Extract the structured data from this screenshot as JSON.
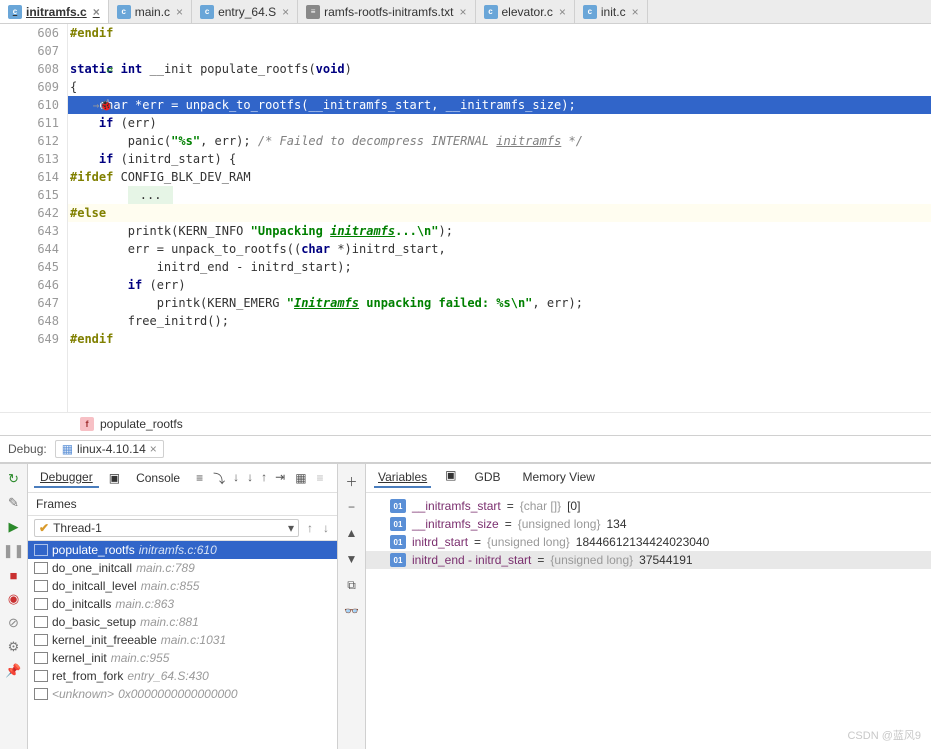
{
  "tabs": [
    {
      "label": "initramfs.c",
      "icon": "c",
      "active": true
    },
    {
      "label": "main.c",
      "icon": "c"
    },
    {
      "label": "entry_64.S",
      "icon": "c"
    },
    {
      "label": "ramfs-rootfs-initramfs.txt",
      "icon": "txt"
    },
    {
      "label": "elevator.c",
      "icon": "c"
    },
    {
      "label": "init.c",
      "icon": "c"
    }
  ],
  "gutter_lines": [
    "606",
    "607",
    "608",
    "609",
    "610",
    "611",
    "612",
    "613",
    "614",
    "615",
    "642",
    "643",
    "644",
    "645",
    "646",
    "647",
    "648",
    "649"
  ],
  "breakpoint_line": "610",
  "folded_line": "615",
  "crumb": {
    "badge": "f",
    "name": "populate_rootfs"
  },
  "debug": {
    "label": "Debug:",
    "config": "linux-4.10.14"
  },
  "debugger_tabs": {
    "debugger": "Debugger",
    "console": "Console"
  },
  "frames_label": "Frames",
  "thread": "Thread-1",
  "frames": [
    {
      "name": "populate_rootfs",
      "loc": "initramfs.c:610",
      "sel": true
    },
    {
      "name": "do_one_initcall",
      "loc": "main.c:789"
    },
    {
      "name": "do_initcall_level",
      "loc": "main.c:855"
    },
    {
      "name": "do_initcalls",
      "loc": "main.c:863"
    },
    {
      "name": "do_basic_setup",
      "loc": "main.c:881"
    },
    {
      "name": "kernel_init_freeable",
      "loc": "main.c:1031"
    },
    {
      "name": "kernel_init",
      "loc": "main.c:955"
    },
    {
      "name": "ret_from_fork",
      "loc": "entry_64.S:430"
    },
    {
      "name": "<unknown>",
      "loc": "0x0000000000000000"
    }
  ],
  "var_tabs": {
    "variables": "Variables",
    "gdb": "GDB",
    "memory": "Memory View"
  },
  "variables": [
    {
      "name": "__initramfs_start",
      "type": "{char []}",
      "value": "[0]"
    },
    {
      "name": "__initramfs_size",
      "type": "{unsigned long}",
      "value": "134"
    },
    {
      "name": "initrd_start",
      "type": "{unsigned long}",
      "value": "18446612134424023040"
    },
    {
      "name": "initrd_end - initrd_start",
      "type": "{unsigned long}",
      "value": "37544191",
      "sel": true
    }
  ],
  "watermark": "CSDN @蓝风9",
  "code": {
    "l606": "#endif",
    "l608a": "static",
    "l608b": "int",
    "l608c": " __init populate_rootfs(",
    "l608d": "void",
    "l608e": ")",
    "l609": "{",
    "l610": "    char *err = unpack_to_rootfs(__initramfs_start, __initramfs_size);",
    "l611a": "    if",
    "l611b": " (err)",
    "l612a": "        panic(",
    "l612s": "\"%s\"",
    "l612b": ", err); ",
    "l612c": "/* Failed to decompress INTERNAL ",
    "l612d": "initramfs",
    "l612e": " */",
    "l613a": "    if",
    "l613b": " (initrd_start) {",
    "l614a": "#ifdef",
    "l614b": " CONFIG_BLK_DEV_RAM",
    "l615": "...",
    "l642": "#else",
    "l643a": "        printk(KERN_INFO ",
    "l643s": "\"Unpacking ",
    "l643d": "initramfs",
    "l643e": "...\\n\"",
    "l643b": ");",
    "l644a": "        err = unpack_to_rootfs((",
    "l644b": "char",
    "l644c": " *)initrd_start,",
    "l645": "            initrd_end - initrd_start);",
    "l646a": "        if",
    "l646b": " (err)",
    "l647a": "            printk(KERN_EMERG ",
    "l647s": "\"",
    "l647d": "Initramfs",
    "l647e": " unpacking failed: %s\\n\"",
    "l647b": ", err);",
    "l648": "        free_initrd();",
    "l649": "#endif"
  }
}
